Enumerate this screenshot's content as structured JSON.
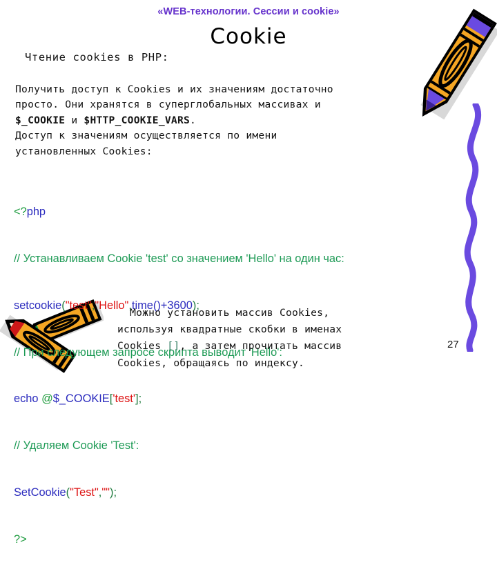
{
  "slide": {
    "kicker": "«WEB-технологии. Сессии и cookie»",
    "title": "Cookie",
    "page_number": "27"
  },
  "lead": "Чтение cookies в PHP:",
  "paragraph": {
    "line1": "Получить доступ к Cookies и их значениям достаточно",
    "line2": "просто. Они хранятся в суперглобальных массивах и",
    "line3_bold_a": "$_COOKIE",
    "line3_mid": " и ",
    "line3_bold_b": "$HTTP_COOKIE_VARS",
    "line3_end": ".",
    "line4": "Доступ к значениям осуществляется по имени",
    "line5": "установленных Cookies:"
  },
  "code": {
    "l1_open": "<?",
    "l1_php": "php",
    "l2_comment": "// Устанавливаем Cookie 'test' со значением 'Hello' на один час:",
    "l3_fn": "setcookie",
    "l3_p1": "(",
    "l3_s1": "\"test\"",
    "l3_c1": ",",
    "l3_s2": "\"Hello\"",
    "l3_c2": ",",
    "l3_fn2": "time",
    "l3_p2": "()",
    "l3_plus": "+",
    "l3_num": "3600",
    "l3_p3": ")",
    "l3_semi": ";",
    "l4_comment": "// При следующем запросе скрипта выводит 'Hello':",
    "l5_echo": "echo ",
    "l5_at": "@",
    "l5_var": "$_COOKIE",
    "l5_b1": "[",
    "l5_str": "'test'",
    "l5_b2": "]",
    "l5_semi": ";",
    "l6_comment": "// Удаляем Cookie 'Test':",
    "l7_fn": "SetCookie",
    "l7_p1": "(",
    "l7_s1": "\"Test\"",
    "l7_c1": ",",
    "l7_s2": "\"\"",
    "l7_p2": ")",
    "l7_semi": ";",
    "l8_close": "?>"
  },
  "footnote": {
    "line1": "  Можно установить массив Cookies,",
    "line2": "используя квадратные скобки в именах",
    "line3_a": "Cookies ",
    "line3_brackets": "[]",
    "line3_b": ", а затем прочитать массив",
    "line4": "Cookies, обращаясь по индексу."
  },
  "colors": {
    "kicker": "#6633cc",
    "code_string": "#dd1111",
    "code_comment": "#1d9a55",
    "code_keyword": "#2b2bbe",
    "code_punct": "#1d7a3c",
    "squiggle": "#6a4ae0",
    "pencil_body": "#f5a623"
  },
  "decorations": {
    "pencil_top": "pencil-icon",
    "pencils_bottom": "crossed-pencils-icon",
    "squiggle": "wavy-line-icon"
  }
}
